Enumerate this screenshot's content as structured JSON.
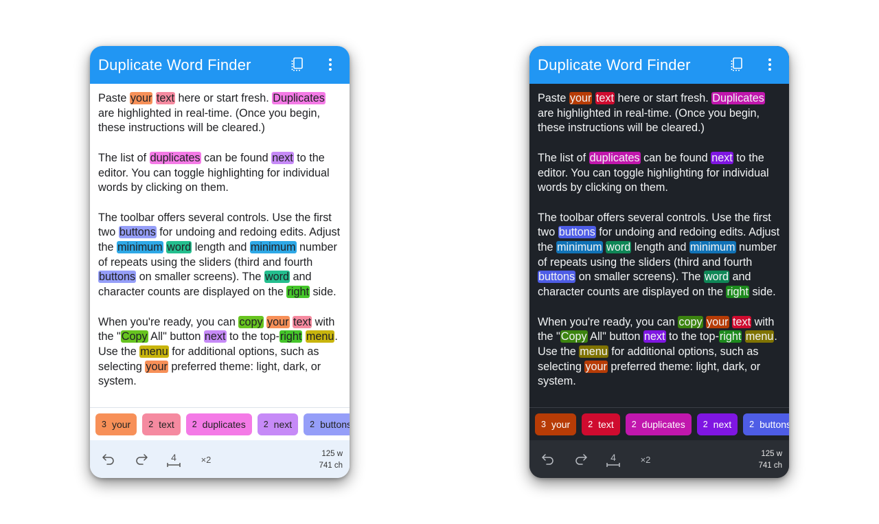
{
  "app": {
    "title": "Duplicate Word Finder",
    "accent_color": "#2196f3",
    "icons": {
      "copy": "copy-all-icon",
      "menu": "more-vert-icon",
      "undo": "undo-icon",
      "redo": "redo-icon",
      "min_length": "min-length-icon"
    }
  },
  "editor": {
    "paragraphs": [
      [
        {
          "t": "Paste "
        },
        {
          "t": "your",
          "w": "your"
        },
        {
          "t": " "
        },
        {
          "t": "text",
          "w": "text"
        },
        {
          "t": " here or start fresh. "
        },
        {
          "t": "Duplicates",
          "w": "duplicates"
        },
        {
          "t": " are highlighted in real-time. (Once you begin, these instructions will be cleared.)"
        }
      ],
      [
        {
          "t": "The list of "
        },
        {
          "t": "duplicates",
          "w": "duplicates"
        },
        {
          "t": " can be found "
        },
        {
          "t": "next",
          "w": "next"
        },
        {
          "t": " to the editor. You can toggle highlighting for individual words by clicking on them."
        }
      ],
      [
        {
          "t": "The toolbar offers several controls. Use the first two "
        },
        {
          "t": "buttons",
          "w": "buttons"
        },
        {
          "t": " for undoing and redoing edits. Adjust the "
        },
        {
          "t": "minimum",
          "w": "minimum"
        },
        {
          "t": " "
        },
        {
          "t": "word",
          "w": "word"
        },
        {
          "t": " length and "
        },
        {
          "t": "minimum",
          "w": "minimum"
        },
        {
          "t": " number of repeats using the sliders (third and fourth "
        },
        {
          "t": "buttons",
          "w": "buttons"
        },
        {
          "t": " on smaller screens). The "
        },
        {
          "t": "word",
          "w": "word"
        },
        {
          "t": " and character counts are displayed on the "
        },
        {
          "t": "right",
          "w": "right"
        },
        {
          "t": " side."
        }
      ],
      [
        {
          "t": "When you're ready, you can "
        },
        {
          "t": "copy",
          "w": "copy"
        },
        {
          "t": " "
        },
        {
          "t": "your",
          "w": "your"
        },
        {
          "t": " "
        },
        {
          "t": "text",
          "w": "text"
        },
        {
          "t": " with the \""
        },
        {
          "t": "Copy",
          "w": "copy"
        },
        {
          "t": " All\" button "
        },
        {
          "t": "next",
          "w": "next"
        },
        {
          "t": " to the top-"
        },
        {
          "t": "right",
          "w": "right"
        },
        {
          "t": " "
        },
        {
          "t": "menu",
          "w": "menu"
        },
        {
          "t": ". Use the "
        },
        {
          "t": "menu",
          "w": "menu"
        },
        {
          "t": " for additional options, such as selecting "
        },
        {
          "t": "your",
          "w": "your"
        },
        {
          "t": " preferred theme: light, dark, or system."
        }
      ]
    ]
  },
  "duplicates": [
    {
      "count": "3",
      "word": "your",
      "key": "your"
    },
    {
      "count": "2",
      "word": "text",
      "key": "text"
    },
    {
      "count": "2",
      "word": "duplicates",
      "key": "duplicates"
    },
    {
      "count": "2",
      "word": "next",
      "key": "next"
    },
    {
      "count": "2",
      "word": "buttons",
      "key": "buttons"
    }
  ],
  "toolbar": {
    "min_word_length": "4",
    "min_repeats": "×2",
    "word_count": "125 w",
    "char_count": "741 ch"
  }
}
